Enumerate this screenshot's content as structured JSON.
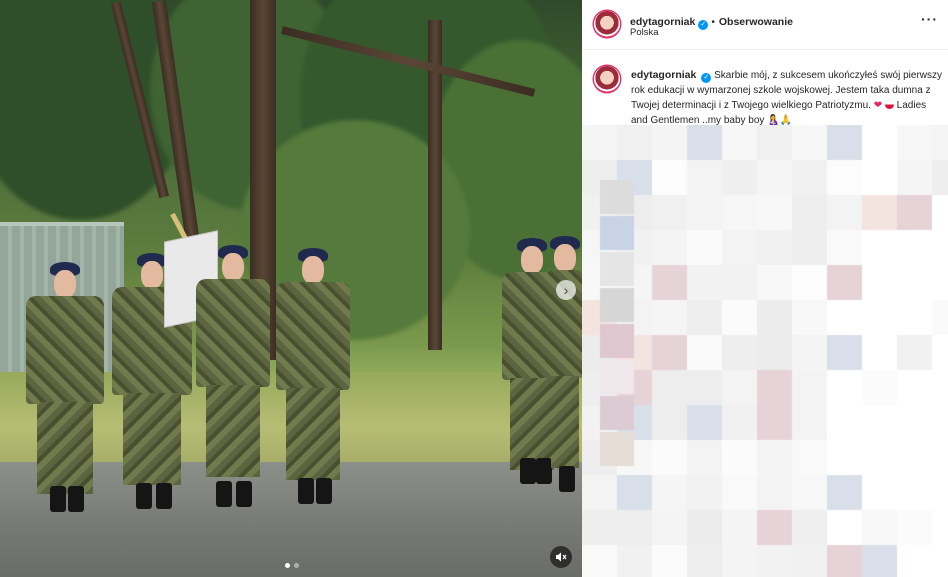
{
  "post": {
    "username": "edytagorniak",
    "separator": "•",
    "follow_label": "Obserwowanie",
    "location": "Polska",
    "more_icon": "more-horizontal-icon",
    "verified_icon": "verified-badge-icon"
  },
  "caption": {
    "username": "edytagorniak",
    "text_1": "Skarbie mój, z sukcesem ukończyłeś swój pierwszy rok edukacji w wymarzonej szkole wojskowej. Jestem taka dumna z Twojej determinacji i z Twojego wielkiego Patriotyzmu.",
    "heart": "❤️",
    "flag_icon": "poland-flag-icon",
    "text_2": "Ladies and Gentlemen ..my baby boy",
    "emoji_1": "🤱",
    "emoji_2": "🙏"
  },
  "media": {
    "next_icon": "chevron-right-icon",
    "mute_icon": "speaker-muted-icon",
    "dots_total": 2,
    "dots_active": 0
  },
  "colors": {
    "verified": "#0095f6",
    "text": "#262626",
    "avatar_ring": "#e1306c"
  }
}
